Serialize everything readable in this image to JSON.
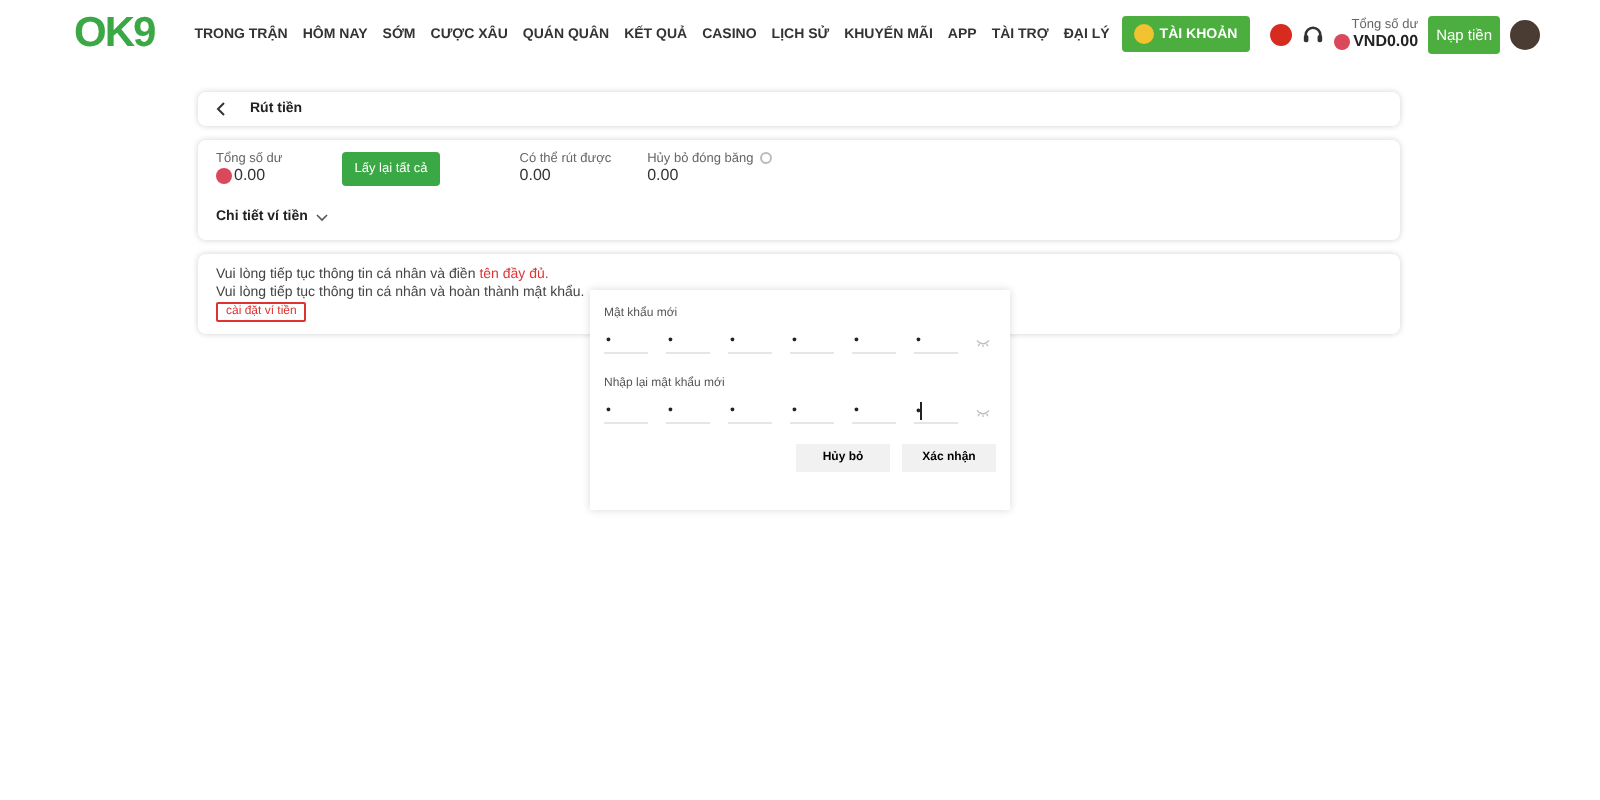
{
  "header": {
    "logo": "OK9",
    "nav": [
      {
        "label": "TRONG TRẬN"
      },
      {
        "label": "HÔM NAY"
      },
      {
        "label": "SỚM"
      },
      {
        "label": "CƯỢC XÂU"
      },
      {
        "label": "QUÁN QUÂN"
      },
      {
        "label": "KẾT QUẢ"
      },
      {
        "label": "CASINO"
      },
      {
        "label": "LỊCH SỬ"
      },
      {
        "label": "KHUYẾN MÃI"
      },
      {
        "label": "APP"
      },
      {
        "label": "TÀI TRỢ"
      },
      {
        "label": "ĐẠI LÝ"
      }
    ],
    "account_button": "TÀI KHOẢN",
    "balance_label": "Tổng số dư",
    "balance": "VND0.00",
    "deposit_button": "Nạp tiền"
  },
  "page_title": "Rút tiền",
  "balance_card": {
    "total_label": "Tổng số dư",
    "total": "0.00",
    "withdraw_all_button": "Lấy lại tất cả",
    "stats": [
      {
        "label": "Có thể rút được",
        "value": "0.00",
        "info": false
      },
      {
        "label": "Hủy bỏ đóng băng",
        "value": "0.00",
        "info": true
      }
    ],
    "details_toggle": "Chi tiết ví tiền",
    "details_expanded": false
  },
  "notice": {
    "line_1": "Vui lòng tiếp tục thông tin cá nhân và điền",
    "line_1_link": "tên đầy đủ.",
    "line_2": "Vui lòng tiếp tục thông tin cá nhân và hoàn thành mật khẩu.",
    "setup_button": "cài đặt ví tiền"
  },
  "password_dialog": {
    "fields": [
      {
        "label": "Mật khẩu mới",
        "cells": [
          "•",
          "•",
          "•",
          "•",
          "•",
          "•"
        ],
        "focused": false
      },
      {
        "label": "Nhập lại mật khẩu mới",
        "cells": [
          "•",
          "•",
          "•",
          "•",
          "•",
          "•"
        ],
        "focused": true
      }
    ],
    "buttons": [
      "Hủy bỏ",
      "Xác nhận"
    ]
  }
}
